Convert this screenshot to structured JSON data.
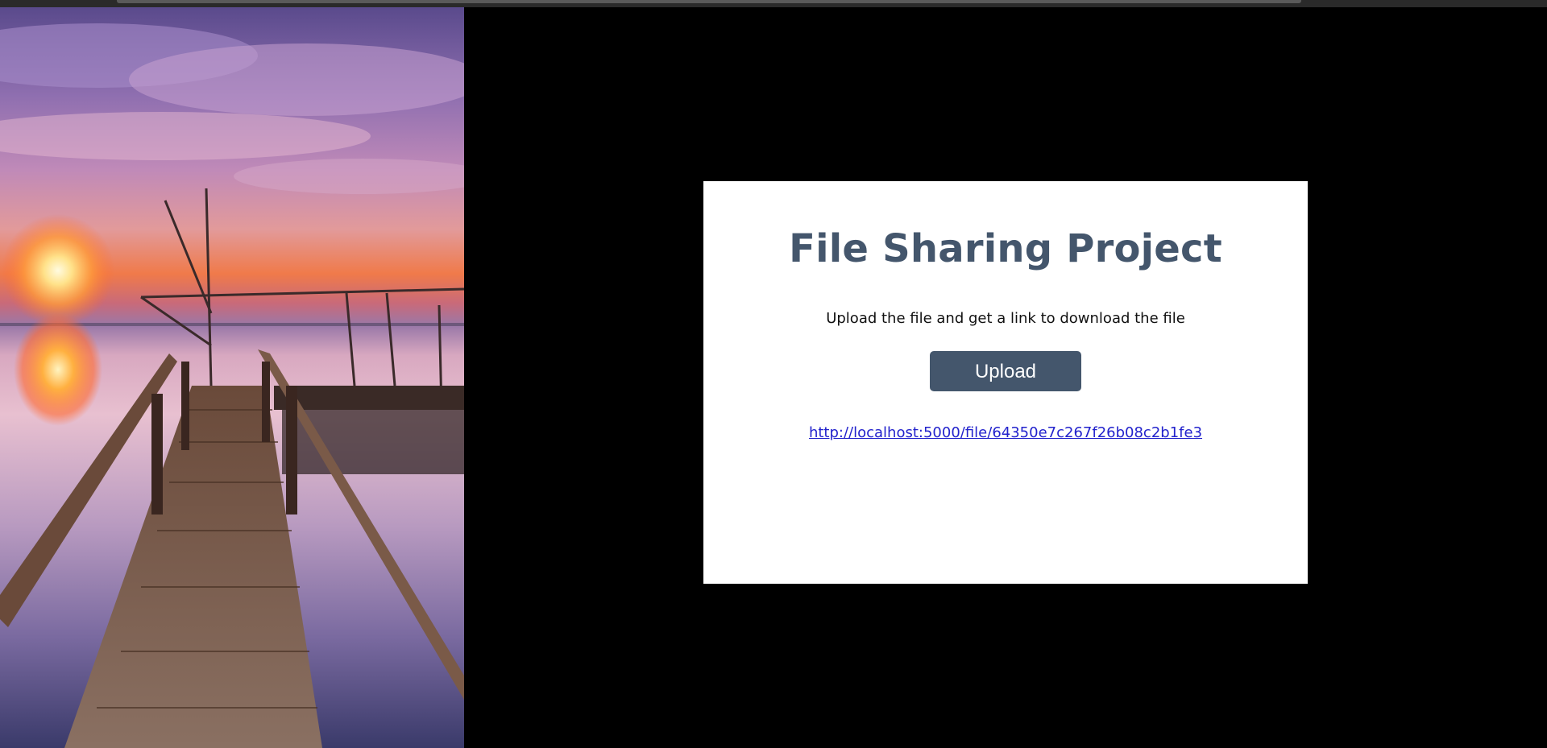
{
  "card": {
    "title": "File Sharing Project",
    "subtitle": "Upload the file and get a link to download the file",
    "upload_label": "Upload",
    "link_text": "http://localhost:5000/file/64350e7c267f26b08c2b1fe3"
  },
  "hero": {
    "image": "sunset-pier-photo"
  },
  "colors": {
    "accent": "#44566c",
    "link": "#2222cc",
    "background": "#000000"
  }
}
